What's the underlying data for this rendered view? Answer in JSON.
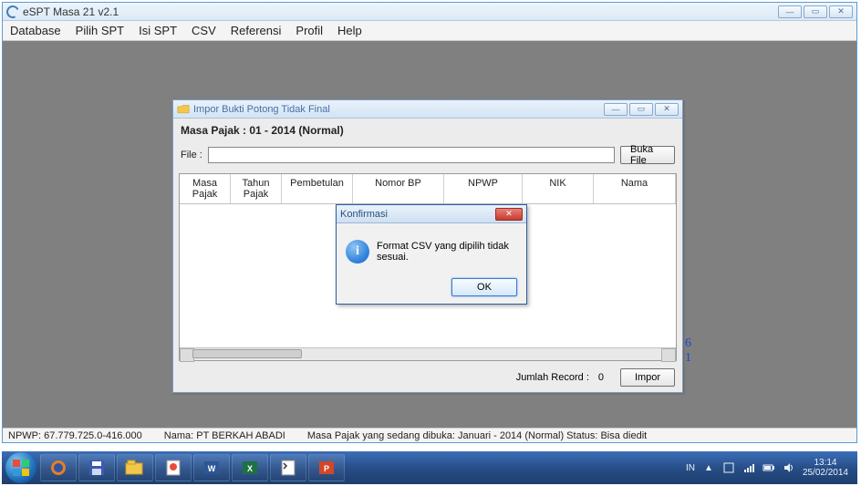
{
  "app": {
    "title": "eSPT Masa 21 v2.1",
    "window_controls": {
      "min": "—",
      "max": "▭",
      "close": "✕"
    }
  },
  "menu": [
    "Database",
    "Pilih SPT",
    "Isi SPT",
    "CSV",
    "Referensi",
    "Profil",
    "Help"
  ],
  "child": {
    "title": "Impor Bukti Potong Tidak Final",
    "masa": "Masa Pajak :  01 - 2014 (Normal)",
    "file_label": "File  :",
    "file_value": "",
    "buka_file": "Buka File",
    "columns": [
      "Masa Pajak",
      "Tahun Pajak",
      "Pembetulan",
      "Nomor BP",
      "NPWP",
      "NIK",
      "Nama"
    ],
    "jumlah_label": "Jumlah Record :",
    "jumlah_value": "0",
    "impor": "Impor"
  },
  "dialog": {
    "title": "Konfirmasi",
    "message": "Format CSV yang dipilih tidak sesuai.",
    "ok": "OK",
    "close": "✕"
  },
  "side_numbers": {
    "a": "6",
    "b": "1"
  },
  "status": {
    "npwp_label": "NPWP:",
    "npwp_value": "67.779.725.0-416.000",
    "nama_label": "Nama:",
    "nama_value": "PT BERKAH ABADI",
    "masa_text": "Masa Pajak yang sedang dibuka: Januari - 2014 (Normal)  Status: Bisa diedit"
  },
  "taskbar": {
    "lang": "IN",
    "time": "13:14",
    "date": "25/02/2014"
  }
}
